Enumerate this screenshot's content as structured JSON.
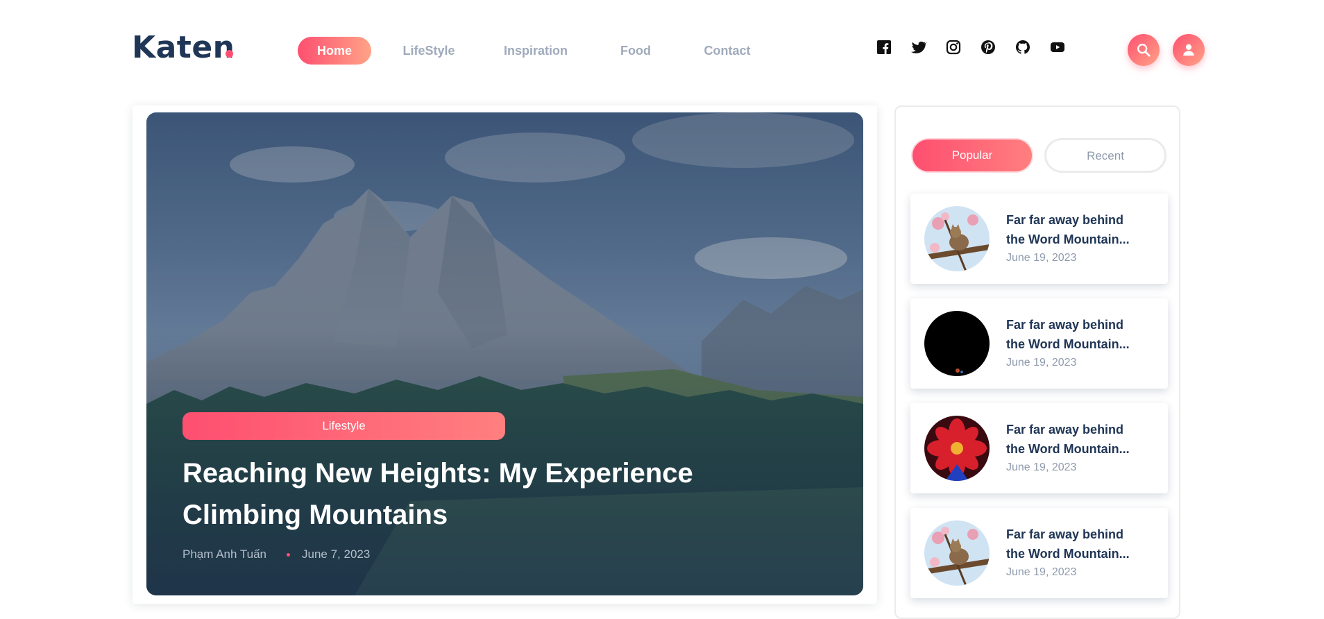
{
  "header": {
    "logo_text": "Katen",
    "nav": [
      {
        "label": "Home",
        "active": true
      },
      {
        "label": "LifeStyle",
        "active": false
      },
      {
        "label": "Inspiration",
        "active": false
      },
      {
        "label": "Food",
        "active": false
      },
      {
        "label": "Contact",
        "active": false
      }
    ],
    "social_icons": [
      "facebook-icon",
      "twitter-icon",
      "instagram-icon",
      "pinterest-icon",
      "github-icon",
      "youtube-icon"
    ],
    "search_icon": "search-icon",
    "user_icon": "user-icon"
  },
  "featured": {
    "category": "Lifestyle",
    "title": "Reaching New Heights: My Experience Climbing Mountains",
    "author": "Phạm Anh Tuấn",
    "date": "June 7, 2023",
    "image": "mountain-landscape"
  },
  "sidebar": {
    "tabs": [
      {
        "label": "Popular",
        "active": true
      },
      {
        "label": "Recent",
        "active": false
      }
    ],
    "posts": [
      {
        "title": "Far far away behind the Word Mountain...",
        "date": "June 19, 2023",
        "thumb": "cat-in-tree"
      },
      {
        "title": "Far far away behind the Word Mountain...",
        "date": "June 19, 2023",
        "thumb": "dark-image"
      },
      {
        "title": "Far far away behind the Word Mountain...",
        "date": "June 19, 2023",
        "thumb": "red-flower"
      },
      {
        "title": "Far far away behind the Word Mountain...",
        "date": "June 19, 2023",
        "thumb": "cat-in-tree"
      }
    ]
  },
  "colors": {
    "brand_navy": "#203656",
    "accent_pink": "#fe4f70",
    "accent_peach": "#ffa387",
    "muted_text": "#9faabb"
  }
}
